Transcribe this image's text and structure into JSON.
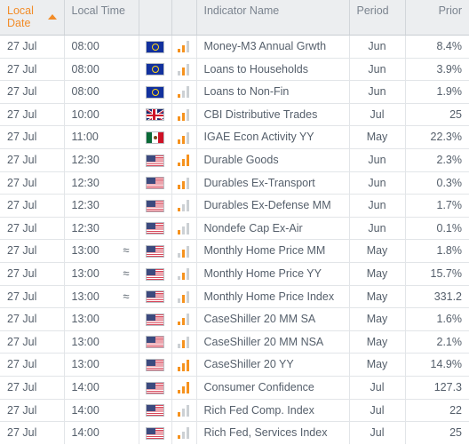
{
  "table": {
    "columns": [
      {
        "key": "local_date",
        "label": "Local Date",
        "sorted": true,
        "sort_dir": "asc",
        "align": "left"
      },
      {
        "key": "local_time",
        "label": "Local Time",
        "sorted": false,
        "align": "left"
      },
      {
        "key": "flag",
        "label": "",
        "sorted": false,
        "align": "center"
      },
      {
        "key": "chart",
        "label": "",
        "sorted": false,
        "align": "center"
      },
      {
        "key": "indicator_name",
        "label": "Indicator Name",
        "sorted": false,
        "align": "left"
      },
      {
        "key": "period",
        "label": "Period",
        "sorted": false,
        "align": "center"
      },
      {
        "key": "prior",
        "label": "Prior",
        "sorted": false,
        "align": "right"
      }
    ],
    "sort_indicator_icon": "sort-ascending-triangle-icon",
    "rows": [
      {
        "local_date": "27 Jul",
        "local_time": "08:00",
        "approx": "",
        "flag": "flag-eu",
        "flag_name": "european-union-flag-icon",
        "chart": [
          1,
          2,
          0
        ],
        "indicator_name": "Money-M3 Annual Grwth",
        "period": "Jun",
        "prior": "8.4%"
      },
      {
        "local_date": "27 Jul",
        "local_time": "08:00",
        "approx": "",
        "flag": "flag-eu",
        "flag_name": "european-union-flag-icon",
        "chart": [
          0,
          2,
          0
        ],
        "indicator_name": "Loans to Households",
        "period": "Jun",
        "prior": "3.9%"
      },
      {
        "local_date": "27 Jul",
        "local_time": "08:00",
        "approx": "",
        "flag": "flag-eu",
        "flag_name": "european-union-flag-icon",
        "chart": [
          1,
          0,
          0
        ],
        "indicator_name": "Loans to Non-Fin",
        "period": "Jun",
        "prior": "1.9%"
      },
      {
        "local_date": "27 Jul",
        "local_time": "10:00",
        "approx": "",
        "flag": "flag-gb",
        "flag_name": "united-kingdom-flag-icon",
        "chart": [
          1,
          2,
          0
        ],
        "indicator_name": "CBI Distributive Trades",
        "period": "Jul",
        "prior": "25"
      },
      {
        "local_date": "27 Jul",
        "local_time": "11:00",
        "approx": "",
        "flag": "flag-mx",
        "flag_name": "mexico-flag-icon",
        "chart": [
          1,
          2,
          0
        ],
        "indicator_name": "IGAE Econ Activity YY",
        "period": "May",
        "prior": "22.3%"
      },
      {
        "local_date": "27 Jul",
        "local_time": "12:30",
        "approx": "",
        "flag": "flag-us",
        "flag_name": "united-states-flag-icon",
        "chart": [
          1,
          2,
          3
        ],
        "indicator_name": "Durable Goods",
        "period": "Jun",
        "prior": "2.3%"
      },
      {
        "local_date": "27 Jul",
        "local_time": "12:30",
        "approx": "",
        "flag": "flag-us",
        "flag_name": "united-states-flag-icon",
        "chart": [
          1,
          2,
          0
        ],
        "indicator_name": "Durables Ex-Transport",
        "period": "Jun",
        "prior": "0.3%"
      },
      {
        "local_date": "27 Jul",
        "local_time": "12:30",
        "approx": "",
        "flag": "flag-us",
        "flag_name": "united-states-flag-icon",
        "chart": [
          1,
          0,
          0
        ],
        "indicator_name": "Durables Ex-Defense MM",
        "period": "Jun",
        "prior": "1.7%"
      },
      {
        "local_date": "27 Jul",
        "local_time": "12:30",
        "approx": "",
        "flag": "flag-us",
        "flag_name": "united-states-flag-icon",
        "chart": [
          1,
          0,
          0
        ],
        "indicator_name": "Nondefe Cap Ex-Air",
        "period": "Jun",
        "prior": "0.1%"
      },
      {
        "local_date": "27 Jul",
        "local_time": "13:00",
        "approx": "≈",
        "flag": "flag-us",
        "flag_name": "united-states-flag-icon",
        "chart": [
          0,
          2,
          0
        ],
        "indicator_name": "Monthly Home Price MM",
        "period": "May",
        "prior": "1.8%"
      },
      {
        "local_date": "27 Jul",
        "local_time": "13:00",
        "approx": "≈",
        "flag": "flag-us",
        "flag_name": "united-states-flag-icon",
        "chart": [
          0,
          2,
          0
        ],
        "indicator_name": "Monthly Home Price YY",
        "period": "May",
        "prior": "15.7%"
      },
      {
        "local_date": "27 Jul",
        "local_time": "13:00",
        "approx": "≈",
        "flag": "flag-us",
        "flag_name": "united-states-flag-icon",
        "chart": [
          0,
          2,
          0
        ],
        "indicator_name": "Monthly Home Price Index",
        "period": "May",
        "prior": "331.2"
      },
      {
        "local_date": "27 Jul",
        "local_time": "13:00",
        "approx": "",
        "flag": "flag-us",
        "flag_name": "united-states-flag-icon",
        "chart": [
          1,
          2,
          0
        ],
        "indicator_name": "CaseShiller 20 MM SA",
        "period": "May",
        "prior": "1.6%"
      },
      {
        "local_date": "27 Jul",
        "local_time": "13:00",
        "approx": "",
        "flag": "flag-us",
        "flag_name": "united-states-flag-icon",
        "chart": [
          0,
          2,
          0
        ],
        "indicator_name": "CaseShiller 20 MM NSA",
        "period": "May",
        "prior": "2.1%"
      },
      {
        "local_date": "27 Jul",
        "local_time": "13:00",
        "approx": "",
        "flag": "flag-us",
        "flag_name": "united-states-flag-icon",
        "chart": [
          1,
          2,
          3
        ],
        "indicator_name": "CaseShiller 20 YY",
        "period": "May",
        "prior": "14.9%"
      },
      {
        "local_date": "27 Jul",
        "local_time": "14:00",
        "approx": "",
        "flag": "flag-us",
        "flag_name": "united-states-flag-icon",
        "chart": [
          1,
          2,
          3
        ],
        "indicator_name": "Consumer Confidence",
        "period": "Jul",
        "prior": "127.3"
      },
      {
        "local_date": "27 Jul",
        "local_time": "14:00",
        "approx": "",
        "flag": "flag-us",
        "flag_name": "united-states-flag-icon",
        "chart": [
          1,
          0,
          0
        ],
        "indicator_name": "Rich Fed Comp. Index",
        "period": "Jul",
        "prior": "22"
      },
      {
        "local_date": "27 Jul",
        "local_time": "14:00",
        "approx": "",
        "flag": "flag-us",
        "flag_name": "united-states-flag-icon",
        "chart": [
          1,
          0,
          0
        ],
        "indicator_name": "Rich Fed, Services Index",
        "period": "Jul",
        "prior": "25"
      }
    ]
  },
  "colors": {
    "accent_orange": "#f28c28",
    "chart_bar_on": "#f6921e",
    "chart_bar_off": "#ccd0d4",
    "header_bg": "#eceef0",
    "header_text": "#7b848f",
    "body_text": "#555f6b",
    "grid_line": "#e2e5e8"
  }
}
